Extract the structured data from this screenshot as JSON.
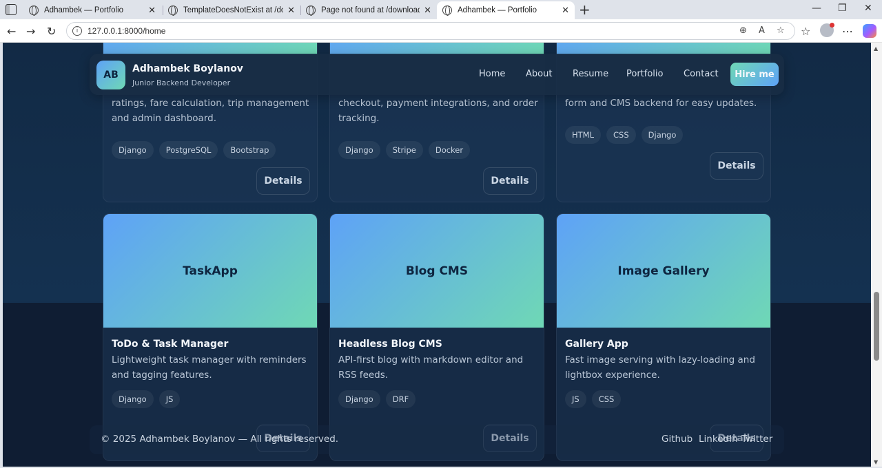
{
  "browser": {
    "tabs": [
      {
        "title": "Adhambek — Portfolio"
      },
      {
        "title": "TemplateDoesNotExist at /download"
      },
      {
        "title": "Page not found at /download/cv/"
      },
      {
        "title": "Adhambek — Portfolio"
      }
    ],
    "url": "127.0.0.1:8000/home"
  },
  "header": {
    "avatar_initials": "AB",
    "name": "Adhambek Boylanov",
    "role": "Junior Backend Developer",
    "nav": [
      "Home",
      "About",
      "Resume",
      "Portfolio",
      "Contact"
    ],
    "cta": "Hire me"
  },
  "top_cards": [
    {
      "desc": "ratings, fare calculation, trip management and admin dashboard.",
      "tags": [
        "Django",
        "PostgreSQL",
        "Bootstrap"
      ],
      "button": "Details"
    },
    {
      "desc": "checkout, payment integrations, and order tracking.",
      "tags": [
        "Django",
        "Stripe",
        "Docker"
      ],
      "button": "Details"
    },
    {
      "desc": "form and CMS backend for easy updates.",
      "tags": [
        "HTML",
        "CSS",
        "Django"
      ],
      "button": "Details"
    }
  ],
  "cards": [
    {
      "thumb": "TaskApp",
      "title": "ToDo & Task Manager",
      "desc": "Lightweight task manager with reminders and tagging features.",
      "tags": [
        "Django",
        "JS"
      ],
      "button": "Details"
    },
    {
      "thumb": "Blog CMS",
      "title": "Headless Blog CMS",
      "desc": "API-first blog with markdown editor and RSS feeds.",
      "tags": [
        "Django",
        "DRF"
      ],
      "button": "Details"
    },
    {
      "thumb": "Image Gallery",
      "title": "Gallery App",
      "desc": "Fast image serving with lazy-loading and lightbox experience.",
      "tags": [
        "JS",
        "CSS"
      ],
      "button": "Details"
    }
  ],
  "footer": {
    "copyright": "© 2025 Adhambek Boylanov — All rights reserved.",
    "links": [
      "Github",
      "LinkedIn",
      "Twitter"
    ]
  },
  "colors": {
    "accent_gradient_start": "#5ea2f7",
    "accent_gradient_end": "#6fd8b5",
    "background": "#122a45"
  }
}
